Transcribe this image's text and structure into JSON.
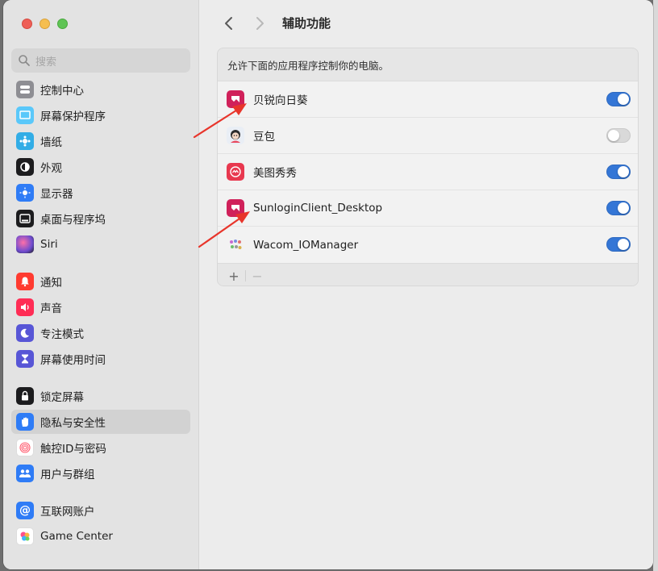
{
  "window": {
    "title": "辅助功能"
  },
  "sidebar": {
    "search_placeholder": "搜索",
    "items": [
      {
        "label": "控制中心",
        "icon": "control-center-icon",
        "color": "#8e8e93"
      },
      {
        "label": "屏幕保护程序",
        "icon": "screensaver-icon",
        "color": "#5ac8fa"
      },
      {
        "label": "墙纸",
        "icon": "wallpaper-icon",
        "color": "#32ade6"
      },
      {
        "label": "外观",
        "icon": "appearance-icon",
        "color": "#1c1c1e"
      },
      {
        "label": "显示器",
        "icon": "display-icon",
        "color": "#2f7cf6"
      },
      {
        "label": "桌面与程序坞",
        "icon": "dock-icon",
        "color": "#1c1c1e"
      },
      {
        "label": "Siri",
        "icon": "siri-icon",
        "color": "#6e4ccf"
      },
      {
        "label": "通知",
        "icon": "notifications-icon",
        "color": "#ff3b30"
      },
      {
        "label": "声音",
        "icon": "sound-icon",
        "color": "#ff2d55"
      },
      {
        "label": "专注模式",
        "icon": "focus-icon",
        "color": "#5856d6"
      },
      {
        "label": "屏幕使用时间",
        "icon": "screen-time-icon",
        "color": "#5856d6"
      },
      {
        "label": "锁定屏幕",
        "icon": "lock-screen-icon",
        "color": "#1c1c1e"
      },
      {
        "label": "隐私与安全性",
        "icon": "privacy-hand-icon",
        "color": "#2f7cf6",
        "selected": true
      },
      {
        "label": "触控ID与密码",
        "icon": "touch-id-icon",
        "color": "#ffffff"
      },
      {
        "label": "用户与群组",
        "icon": "users-groups-icon",
        "color": "#2f7cf6"
      },
      {
        "label": "互联网账户",
        "icon": "internet-accounts-icon",
        "color": "#2f7cf6"
      },
      {
        "label": "Game Center",
        "icon": "game-center-icon",
        "color": "#ffffff"
      }
    ]
  },
  "main": {
    "description": "允许下面的应用程序控制你的电脑。",
    "apps": [
      {
        "name": "贝锐向日葵",
        "icon": "sunlogin-icon",
        "enabled": true
      },
      {
        "name": "豆包",
        "icon": "doubao-icon",
        "enabled": false
      },
      {
        "name": "美图秀秀",
        "icon": "meitu-icon",
        "enabled": true
      },
      {
        "name": "SunloginClient_Desktop",
        "icon": "sunlogin-client-icon",
        "enabled": true
      },
      {
        "name": "Wacom_IOManager",
        "icon": "wacom-icon",
        "enabled": true
      }
    ],
    "add_label": "+",
    "remove_label": "−"
  },
  "colors": {
    "accent": "#3476d6",
    "annotation_arrow": "#e8352b",
    "sunlogin": "#d0215a"
  }
}
